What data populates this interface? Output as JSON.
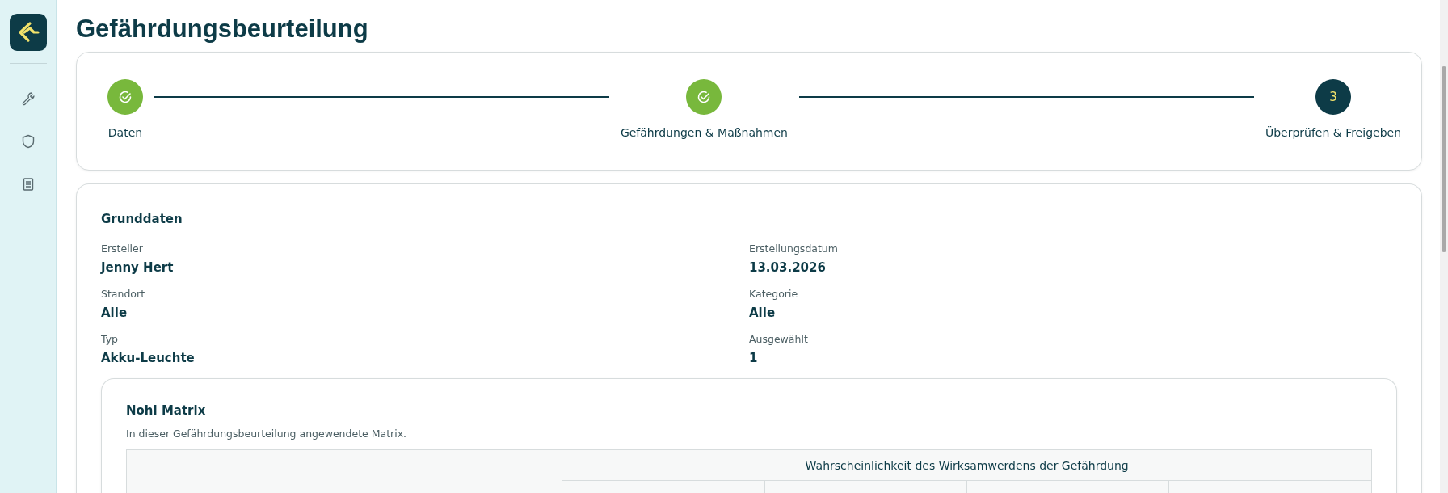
{
  "sidebar": {
    "items": [
      {
        "kind": "wrench",
        "selected": false
      },
      {
        "kind": "shield",
        "selected": false
      },
      {
        "kind": "book",
        "selected": false
      }
    ]
  },
  "title": "Gefährdungsbeurteilung",
  "stepper": [
    {
      "label": "Daten",
      "kind": "done"
    },
    {
      "label": "Gefährdungen & Maßnahmen",
      "kind": "done"
    },
    {
      "label": "Überprüfen & Freigeben",
      "kind": "current",
      "number": "3"
    }
  ],
  "grunddaten": {
    "heading": "Grunddaten",
    "fields": [
      {
        "label": "Ersteller",
        "value": "Jenny Hert"
      },
      {
        "label": "Erstellungsdatum",
        "value": "13.03.2026"
      },
      {
        "label": "Standort",
        "value": "Alle"
      },
      {
        "label": "Kategorie",
        "value": "Alle"
      },
      {
        "label": "Typ",
        "value": "Akku-Leuchte"
      },
      {
        "label": "Ausgewählt",
        "value": "1"
      }
    ]
  },
  "matrix": {
    "heading": "Nohl Matrix",
    "description": "In dieser Gefährdungsbeurteilung angewendete Matrix.",
    "column_header": "Wahrscheinlichkeit des Wirksamwerdens der Gefährdung"
  }
}
